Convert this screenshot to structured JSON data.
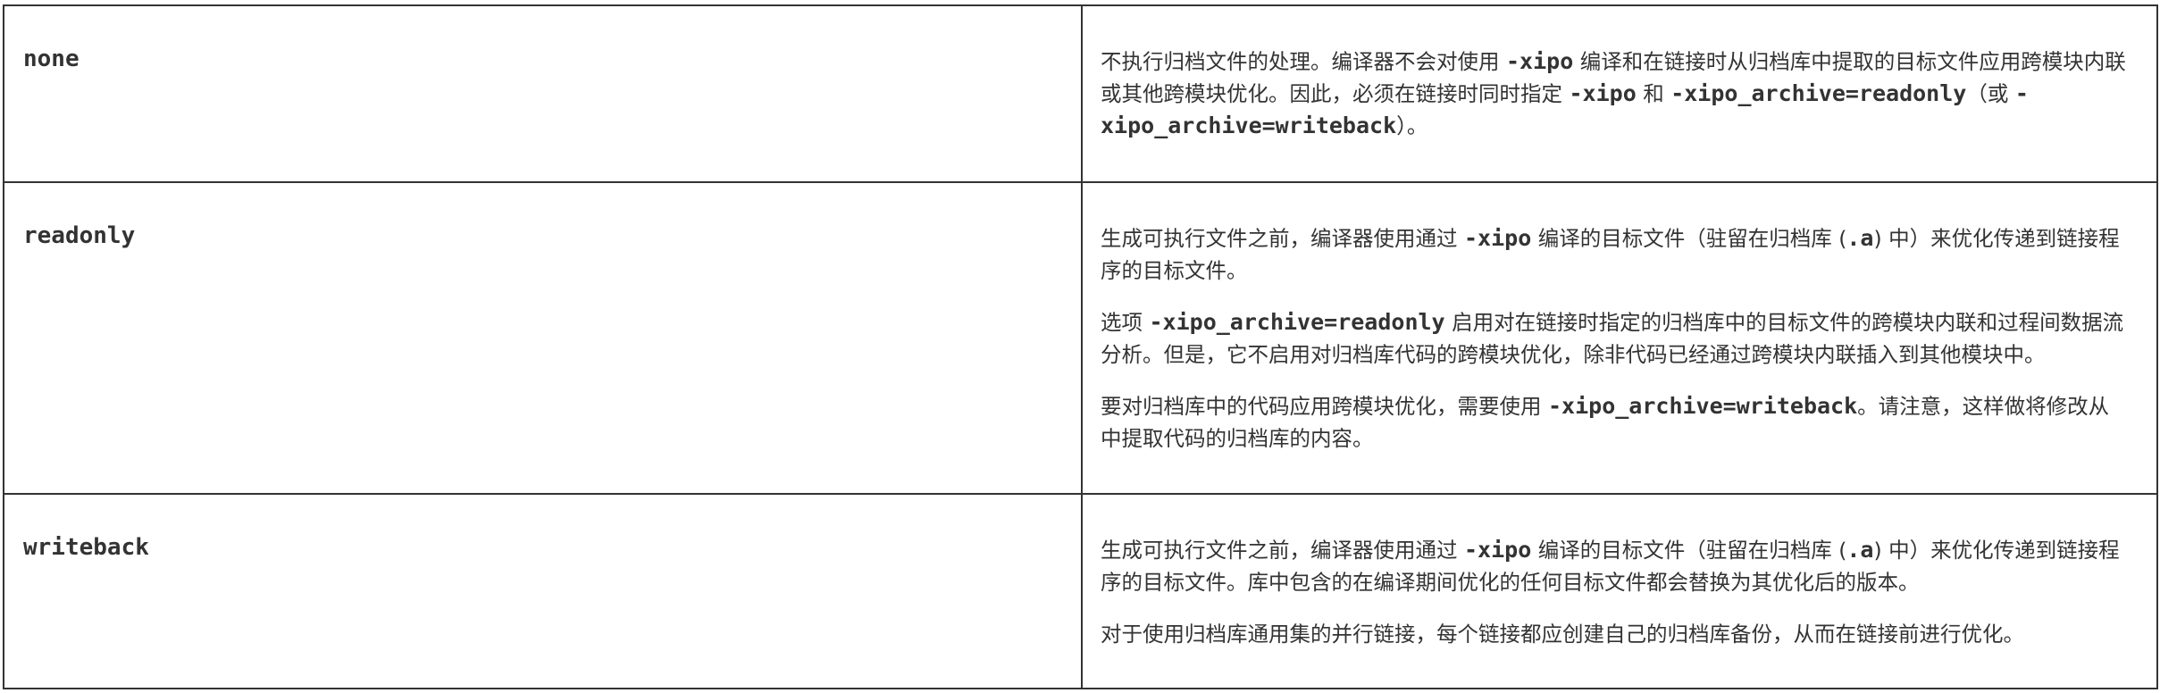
{
  "rows": [
    {
      "key": "none",
      "paragraphs": [
        [
          {
            "t": "不执行归档文件的处理。编译器不会对使用 "
          },
          {
            "c": "-xipo"
          },
          {
            "t": " 编译和在链接时从归档库中提取的目标文件应用跨模块内联或其他跨模块优化。因此，必须在链接时同时指定 "
          },
          {
            "c": "-xipo"
          },
          {
            "t": " 和 "
          },
          {
            "c": "-xipo_archive=readonly"
          },
          {
            "t": "（或 "
          },
          {
            "c": "-xipo_archive=writeback"
          },
          {
            "t": "）。"
          }
        ]
      ]
    },
    {
      "key": "readonly",
      "paragraphs": [
        [
          {
            "t": "生成可执行文件之前，编译器使用通过 "
          },
          {
            "c": "-xipo"
          },
          {
            "t": " 编译的目标文件（驻留在归档库 ("
          },
          {
            "c": ".a"
          },
          {
            "t": ") 中）来优化传递到链接程序的目标文件。"
          }
        ],
        [
          {
            "t": "选项 "
          },
          {
            "c": "-xipo_archive=readonly"
          },
          {
            "t": " 启用对在链接时指定的归档库中的目标文件的跨模块内联和过程间数据流分析。但是，它不启用对归档库代码的跨模块优化，除非代码已经通过跨模块内联插入到其他模块中。"
          }
        ],
        [
          {
            "t": "要对归档库中的代码应用跨模块优化，需要使用 "
          },
          {
            "c": "-xipo_archive=writeback"
          },
          {
            "t": "。请注意，这样做将修改从中提取代码的归档库的内容。"
          }
        ]
      ]
    },
    {
      "key": "writeback",
      "paragraphs": [
        [
          {
            "t": "生成可执行文件之前，编译器使用通过 "
          },
          {
            "c": "-xipo"
          },
          {
            "t": " 编译的目标文件（驻留在归档库 ("
          },
          {
            "c": ".a"
          },
          {
            "t": ") 中）来优化传递到链接程序的目标文件。库中包含的在编译期间优化的任何目标文件都会替换为其优化后的版本。"
          }
        ],
        [
          {
            "t": "对于使用归档库通用集的并行链接，每个链接都应创建自己的归档库备份，从而在链接前进行优化。"
          }
        ]
      ]
    }
  ]
}
